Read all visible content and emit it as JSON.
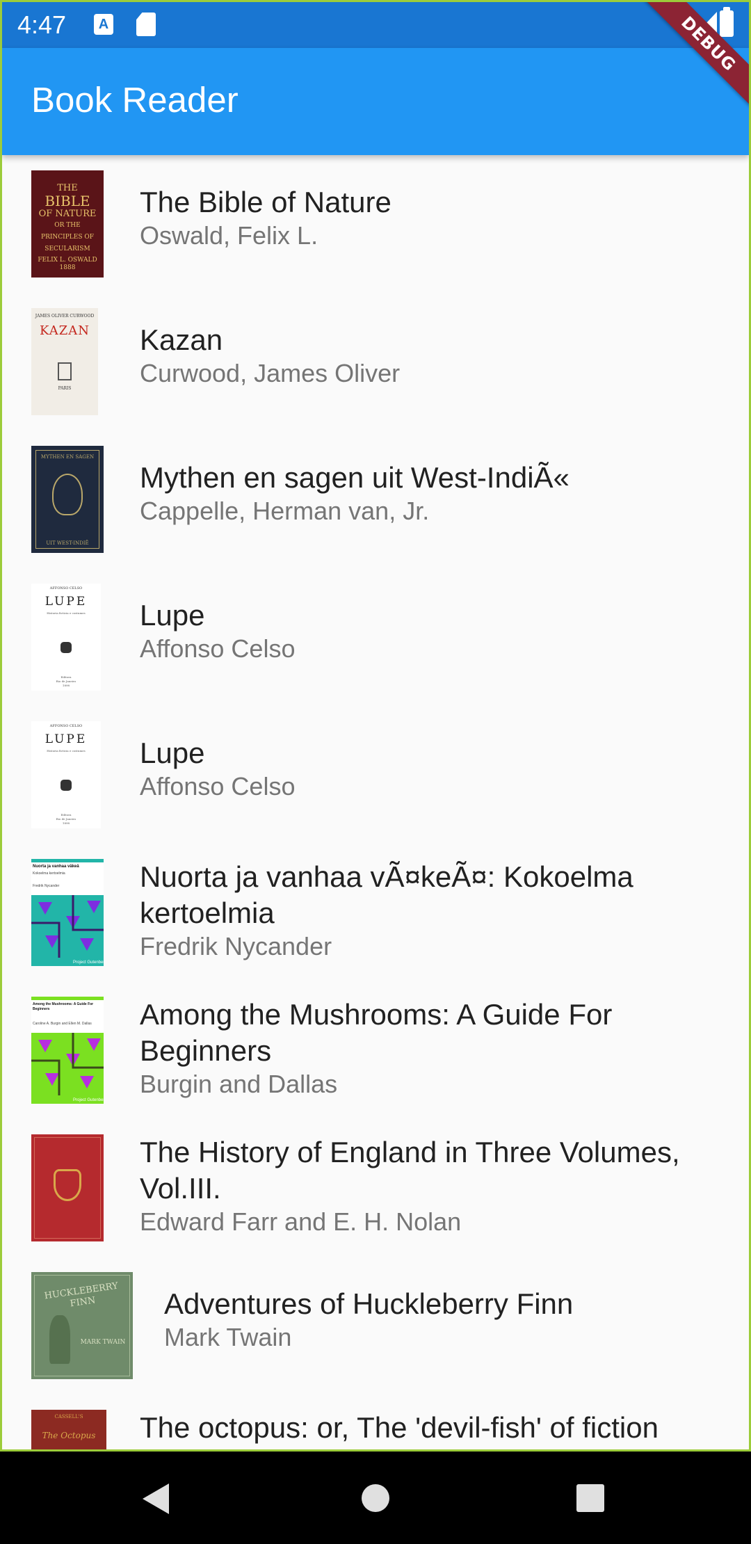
{
  "status_bar": {
    "time": "4:47",
    "icons": [
      "a-keyboard-icon",
      "sd-card-icon",
      "wifi-icon",
      "signal-icon",
      "battery-icon"
    ]
  },
  "app_bar": {
    "title": "Book Reader",
    "color": "#2196f3",
    "debug_label": "DEBUG"
  },
  "books": [
    {
      "title": "The Bible of Nature",
      "author": "Oswald, Felix L.",
      "cover_text": "THE BIBLE OF NATURE OR THE PRINCIPLES OF SECULARISM FELIX L. OSWALD 1888",
      "cover_color": "#5a1418"
    },
    {
      "title": "Kazan",
      "author": "Curwood, James Oliver",
      "cover_text": "KAZAN",
      "cover_color": "#f1ede6"
    },
    {
      "title": "Mythen en sagen uit West-IndiÃ«",
      "author": "Cappelle, Herman van, Jr.",
      "cover_text": "MYTHEN EN SAGEN",
      "cover_color": "#1f2a3e"
    },
    {
      "title": "Lupe",
      "author": "Affonso Celso",
      "cover_text": "LUPE",
      "cover_color": "#ffffff"
    },
    {
      "title": "Lupe",
      "author": "Affonso Celso",
      "cover_text": "LUPE",
      "cover_color": "#ffffff"
    },
    {
      "title": "Nuorta ja vanhaa vÃ¤keÃ¤: Kokoelma kertoelmia",
      "author": "Fredrik Nycander",
      "cover_text": "Nuorta ja vanhaa väkeä",
      "cover_color": "#22b5a8"
    },
    {
      "title": "Among the Mushrooms: A Guide For Beginners",
      "author": "Burgin and Dallas",
      "cover_text": "Among the Mushrooms: A Guide For Beginners",
      "cover_color": "#7be021"
    },
    {
      "title": "The History of England in Three Volumes, Vol.III.",
      "author": "Edward Farr and E. H. Nolan",
      "cover_text": "",
      "cover_color": "#b52a2e"
    },
    {
      "title": "Adventures of Huckleberry Finn",
      "author": "Mark Twain",
      "cover_text": "HUCKLEBERRY FINN MARK TWAIN",
      "cover_color": "#6f8b6a"
    },
    {
      "title": "The octopus: or, The 'devil-fish' of fiction",
      "author": "",
      "cover_text": "The Octopus",
      "cover_color": "#8c2a22"
    }
  ]
}
